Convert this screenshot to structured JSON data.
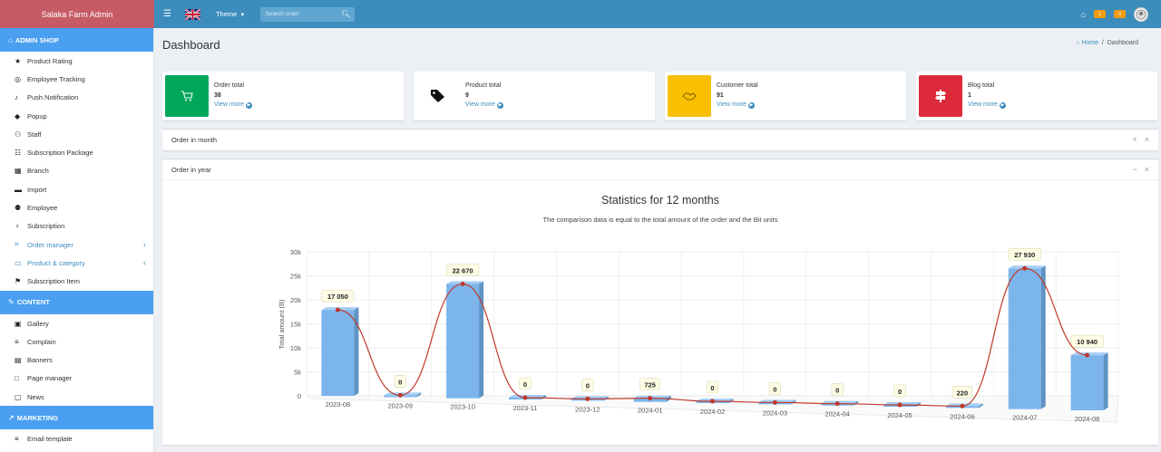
{
  "app": {
    "title": "Salaka Farm Admin"
  },
  "topbar": {
    "theme_label": "Theme",
    "search_placeholder": "Search order",
    "notif_badge": "1",
    "msg_badge": "0"
  },
  "sidebar": {
    "sections": [
      {
        "title": "ADMIN SHOP",
        "icon": "shop-icon",
        "items": [
          {
            "label": "Product Rating",
            "icon": "star-icon"
          },
          {
            "label": "Employee Tracking",
            "icon": "globe-icon"
          },
          {
            "label": "Push Notification",
            "icon": "bell-icon"
          },
          {
            "label": "Popup",
            "icon": "drop-icon"
          },
          {
            "label": "Staff",
            "icon": "users-icon"
          },
          {
            "label": "Subscription Package",
            "icon": "sitemap-icon"
          },
          {
            "label": "Branch",
            "icon": "building-icon"
          },
          {
            "label": "Import",
            "icon": "truck-icon"
          },
          {
            "label": "Employee",
            "icon": "user-group-icon"
          },
          {
            "label": "Subscription",
            "icon": "award-icon"
          },
          {
            "label": "Order manager",
            "icon": "cart-icon",
            "active": true,
            "expand": true
          },
          {
            "label": "Product & category",
            "icon": "folder-icon",
            "active": true,
            "expand": true
          },
          {
            "label": "Subscription Item",
            "icon": "sign-icon"
          }
        ]
      },
      {
        "title": "CONTENT",
        "icon": "edit-icon",
        "items": [
          {
            "label": "Gallery",
            "icon": "gallery-icon"
          },
          {
            "label": "Complain",
            "icon": "list-icon"
          },
          {
            "label": "Banners",
            "icon": "banner-icon"
          },
          {
            "label": "Page manager",
            "icon": "page-icon"
          },
          {
            "label": "News",
            "icon": "news-icon"
          }
        ]
      },
      {
        "title": "MARKETING",
        "icon": "marketing-icon",
        "items": [
          {
            "label": "Email template",
            "icon": "list-icon"
          }
        ]
      }
    ]
  },
  "page": {
    "title": "Dashboard",
    "breadcrumb_home": "Home",
    "breadcrumb_current": "Dashboard"
  },
  "info_boxes": [
    {
      "label": "Order total",
      "value": "38",
      "link": "View more",
      "color": "#00a65a",
      "icon": "cart-icon"
    },
    {
      "label": "Product total",
      "value": "9",
      "link": "View more",
      "color": "#ffffff",
      "icon": "tags-icon"
    },
    {
      "label": "Customer total",
      "value": "91",
      "link": "View more",
      "color": "#f8c000",
      "icon": "handshake-icon"
    },
    {
      "label": "Blog total",
      "value": "1",
      "link": "View more",
      "color": "#dd2b3b",
      "icon": "signpost-icon"
    }
  ],
  "boxes": {
    "order_in_month": "Order in month",
    "order_in_year": "Order in year"
  },
  "chart_data": {
    "type": "bar",
    "title": "Statistics for 12 months",
    "subtitle": "The comparison data is equal to the total amount of the order and the Bit units",
    "ylabel": "Total amount (B)",
    "ylim": [
      0,
      30000
    ],
    "yticks": [
      "0",
      "5k",
      "10k",
      "15k",
      "20k",
      "25k",
      "30k"
    ],
    "categories": [
      "2023-08",
      "2023-09",
      "2023-10",
      "2023-11",
      "2023-12",
      "2024-01",
      "2024-02",
      "2024-03",
      "2024-04",
      "2024-05",
      "2024-06",
      "2024-07",
      "2024-08"
    ],
    "values": [
      17050,
      0,
      22670,
      0,
      0,
      725,
      0,
      0,
      0,
      0,
      220,
      27930,
      10940
    ],
    "data_labels": [
      "17 050",
      "0",
      "22 670",
      "0",
      "0",
      "725",
      "0",
      "0",
      "0",
      "0",
      "220",
      "27 930",
      "10 940"
    ],
    "bar_color": "#7cb5ec",
    "line_color": "#c0392b",
    "grid": true
  }
}
